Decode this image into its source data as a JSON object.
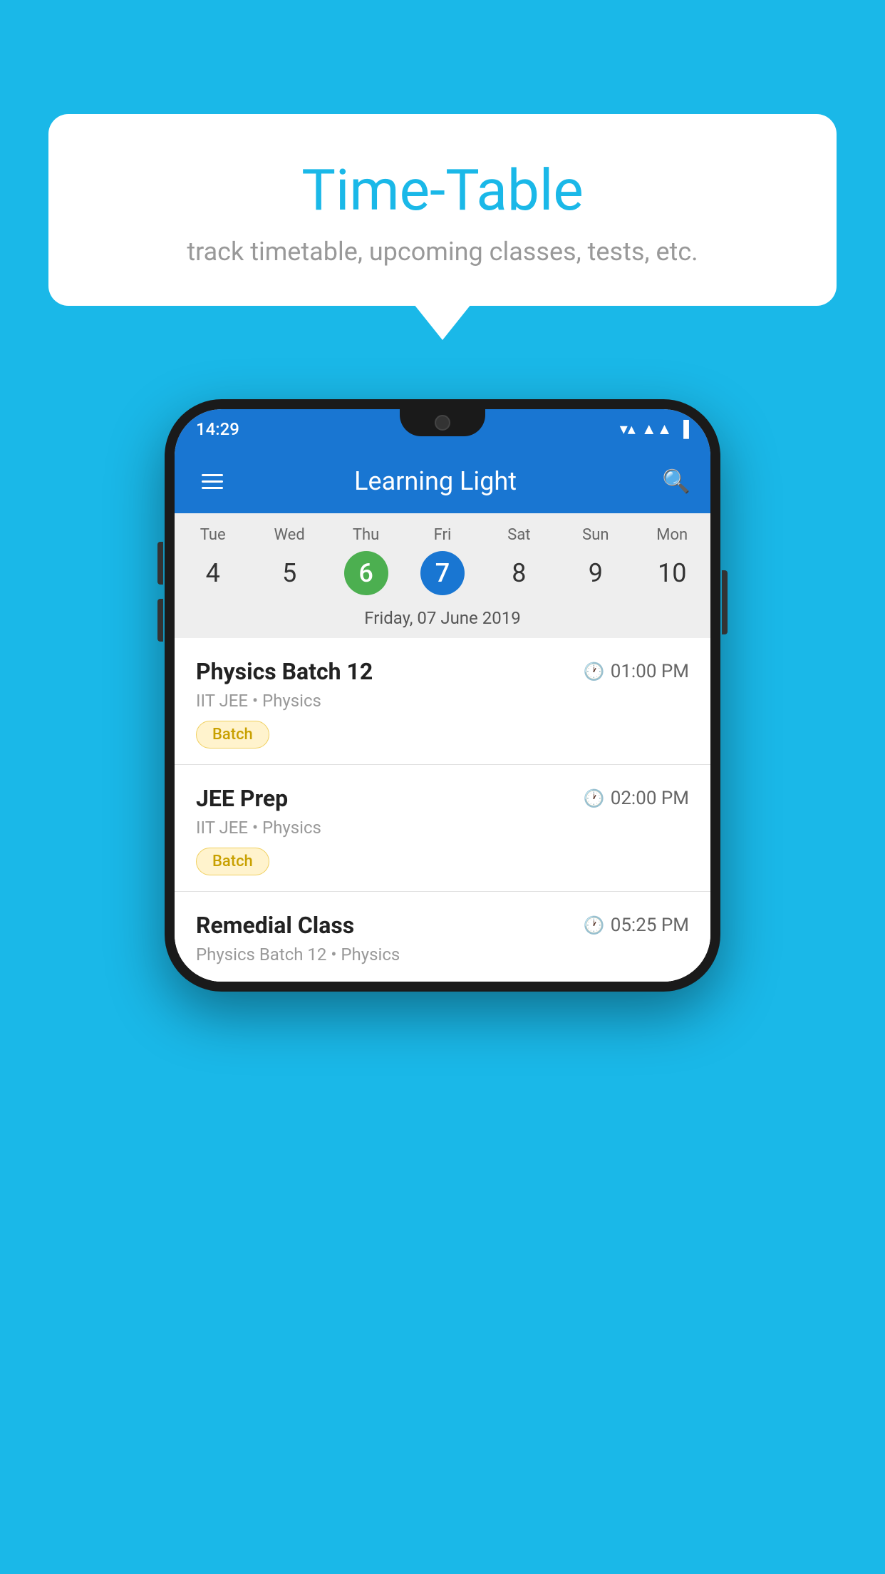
{
  "background_color": "#1ab8e8",
  "bubble": {
    "title": "Time-Table",
    "subtitle": "track timetable, upcoming classes, tests, etc."
  },
  "phone": {
    "status_bar": {
      "time": "14:29"
    },
    "app_bar": {
      "title": "Learning Light"
    },
    "calendar": {
      "days": [
        {
          "name": "Tue",
          "num": "4",
          "state": "normal"
        },
        {
          "name": "Wed",
          "num": "5",
          "state": "normal"
        },
        {
          "name": "Thu",
          "num": "6",
          "state": "today"
        },
        {
          "name": "Fri",
          "num": "7",
          "state": "selected"
        },
        {
          "name": "Sat",
          "num": "8",
          "state": "normal"
        },
        {
          "name": "Sun",
          "num": "9",
          "state": "normal"
        },
        {
          "name": "Mon",
          "num": "10",
          "state": "normal"
        }
      ],
      "selected_date_label": "Friday, 07 June 2019"
    },
    "schedule": [
      {
        "name": "Physics Batch 12",
        "time": "01:00 PM",
        "meta": "IIT JEE • Physics",
        "tag": "Batch"
      },
      {
        "name": "JEE Prep",
        "time": "02:00 PM",
        "meta": "IIT JEE • Physics",
        "tag": "Batch"
      },
      {
        "name": "Remedial Class",
        "time": "05:25 PM",
        "meta": "Physics Batch 12 • Physics",
        "tag": null
      }
    ]
  }
}
